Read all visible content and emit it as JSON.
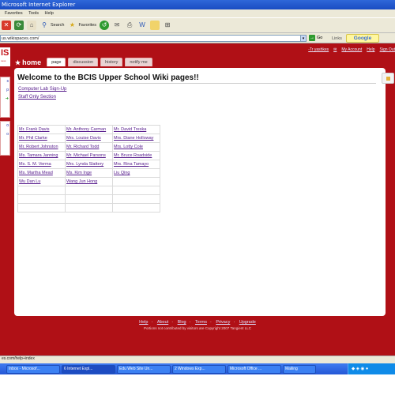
{
  "window": {
    "title": "Microsoft Internet Explorer"
  },
  "menu": {
    "items": [
      "Favorites",
      "Tools",
      "Help"
    ]
  },
  "toolbar": {
    "search_label": "Search",
    "favorites_label": "Favorites"
  },
  "address": {
    "value": "us.wikispaces.com/",
    "go_label": "Go",
    "links_label": "Links",
    "google_label": "Google"
  },
  "site": {
    "logo_text": "IS",
    "logo_small": "ness",
    "top_links": [
      "-Tr yashkes",
      "My Account",
      "Help",
      "Sign Out"
    ],
    "home_label": "home",
    "tabs": [
      "page",
      "discussion",
      "history",
      "notify me"
    ],
    "side_items": [
      "s",
      "p",
      "o",
      "o"
    ]
  },
  "content": {
    "title": "Welcome to the BCIS Upper School Wiki pages!!",
    "links": [
      "Computer Lab Sign-Up",
      "Staff Only Section"
    ],
    "staff_table": [
      [
        "Mr. Frank Davis",
        "Mr. Anthony Carman",
        "Mr. David Treska"
      ],
      [
        "Mr. Phil Clarke",
        "Mrs. Louise Davis",
        "Mrs. Diane Holloway"
      ],
      [
        "Mr. Robert Johnston",
        "Mr. Richard Todd",
        "Mrs. Lotty Cole"
      ],
      [
        "Ms. Tamara Janning",
        "Mr. Michael Parsons",
        "Mr. Bruce Roadside"
      ],
      [
        "Ms. S. M. Verma",
        "Mrs. Lynda Slattery",
        "Mrs. Rina Tamayo"
      ],
      [
        "Ms. Martha Mead",
        "Ms. Kim Inge",
        "Liu Qing"
      ],
      [
        "Wu Dan Lu",
        "Wang Jun Hong",
        ""
      ],
      [
        "",
        "",
        ""
      ],
      [
        "",
        "",
        ""
      ],
      [
        "",
        "",
        ""
      ]
    ]
  },
  "footer": {
    "links": [
      "Help",
      "About",
      "Blog",
      "Terms",
      "Privacy",
      "Upgrade"
    ],
    "note": "Portions not contributed by visitors are Copyright 2007 Tangient LLC"
  },
  "status": {
    "text": "es.com/help+index"
  },
  "taskbar": {
    "buttons": [
      "Inbox - Microsof...",
      "6 Internet Expl...",
      "Edu Web Site Un...",
      "2 Windows Exp...",
      "Microsoft Office ...",
      "Mailing"
    ],
    "lang": "EN"
  }
}
